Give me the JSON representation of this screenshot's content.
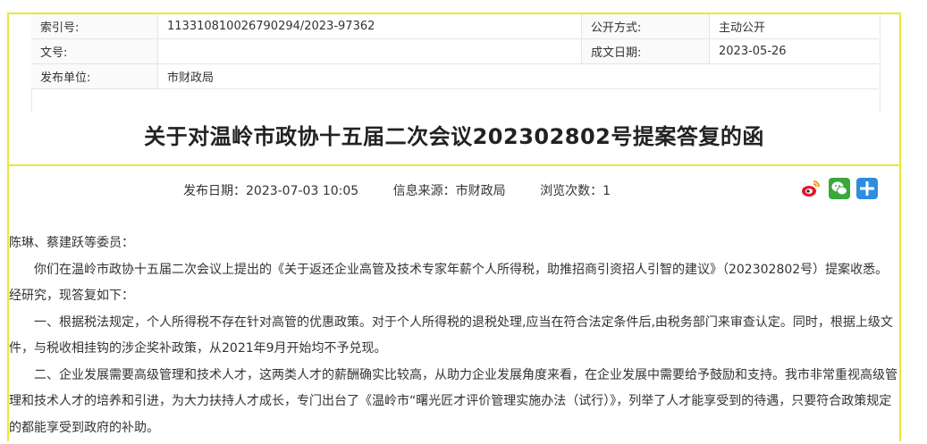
{
  "meta": {
    "index_label": "索引号:",
    "index_value": "113310810026790294/2023-97362",
    "open_label": "公开方式:",
    "open_value": "主动公开",
    "doc_label": "文号:",
    "doc_value": "",
    "date_label": "成文日期:",
    "date_value": "2023-05-26",
    "unit_label": "发布单位:",
    "unit_value": "市财政局"
  },
  "title": "关于对温岭市政协十五届二次会议202302802号提案答复的函",
  "info": {
    "publish": "发布日期：2023-07-03 10:05",
    "source": "信息来源：市财政局",
    "views": "浏览次数：1"
  },
  "body": {
    "greeting": "陈琳、蔡建跃等委员：",
    "p1": "你们在温岭市政协十五届二次会议上提出的《关于返还企业高管及技术专家年薪个人所得税，助推招商引资招人引智的建议》（202302802号）提案收悉。经研究，现答复如下：",
    "p2": "一、根据税法规定，个人所得税不存在针对高管的优惠政策。对于个人所得税的退税处理,应当在符合法定条件后,由税务部门来审查认定。同时，根据上级文件，与税收相挂钩的涉企奖补政策，从2021年9月开始均不予兑现。",
    "p3": "二、企业发展需要高级管理和技术人才，这两类人才的薪酬确实比较高，从助力企业发展角度来看，在企业发展中需要给予鼓励和支持。我市非常重视高级管理和技术人才的培养和引进，为大力扶持人才成长，专门出台了《温岭市“曙光匠才评价管理实施办法（试行）》，列举了人才能享受到的待遇，只要符合政策规定的都能享受到政府的补助。"
  },
  "icons": {
    "weibo": "weibo-icon",
    "wechat": "wechat-icon",
    "plus": "share-plus-icon"
  },
  "colors": {
    "frame": "#e8e83a",
    "wechat": "#3aa83a",
    "plus": "#2d8de0",
    "weibo": "#e6162d"
  }
}
